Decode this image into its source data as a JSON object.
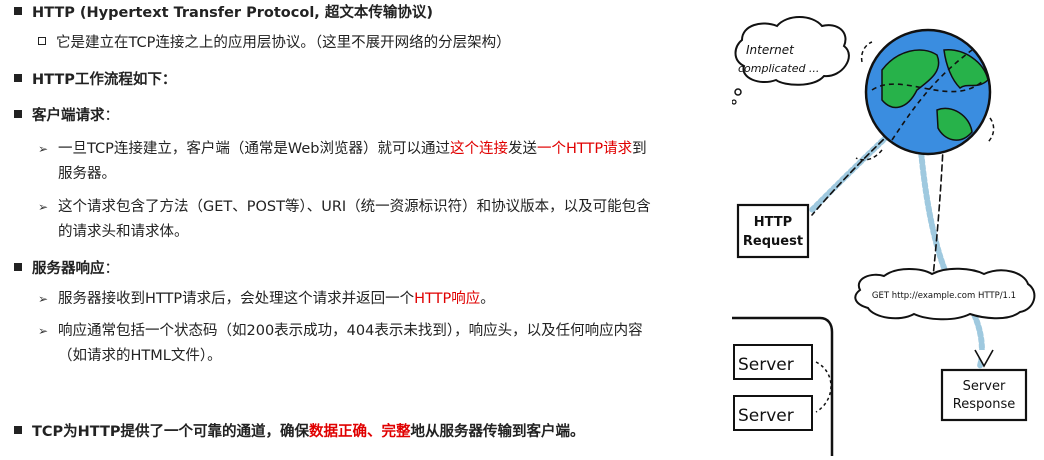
{
  "bullets": {
    "http_title": "HTTP (Hypertext Transfer Protocol, 超文本传输协议)",
    "http_sub": "它是建立在TCP连接之上的应用层协议。（这里不展开网络的分层架构）",
    "workflow": "HTTP工作流程如下：",
    "client_req_bold": "客户端请求",
    "client_req_colon": "：",
    "req1_a": "一旦TCP连接建立，客户端（通常是Web浏览器）就可以通过",
    "req1_red1": "这个连接",
    "req1_b": "发送",
    "req1_red2": "一个HTTP请求",
    "req1_c": "到",
    "req1_cont": "服务器。",
    "req2_line1": "这个请求包含了方法（GET、POST等）、URI（统一资源标识符）和协议版本，以及可能包含",
    "req2_line2": "的请求头和请求体。",
    "server_resp_bold": "服务器响应",
    "server_resp_colon": "：",
    "resp1_a": "服务器接收到HTTP请求后，会处理这个请求并返回一个",
    "resp1_red": "HTTP响应",
    "resp1_b": "。",
    "resp2_line1": "响应通常包括一个状态码（如200表示成功，404表示未找到），响应头，以及任何响应内容",
    "resp2_line2": "（如请求的HTML文件）。",
    "tcp_a": "TCP为HTTP提供了一个可靠的通道，确保",
    "tcp_red1": "数据正确、",
    "tcp_red2": "完整",
    "tcp_b": "地从服务器传输到客户端。"
  },
  "figure": {
    "cloud_line1": "Internet",
    "cloud_line2": "complicated ...",
    "http_request_line1": "HTTP",
    "http_request_line2": "Request",
    "get_line": "GET http://example.com   HTTP/1.1",
    "server1": "Server",
    "server2": "Server",
    "server_response_line1": "Server",
    "server_response_line2": "Response"
  }
}
